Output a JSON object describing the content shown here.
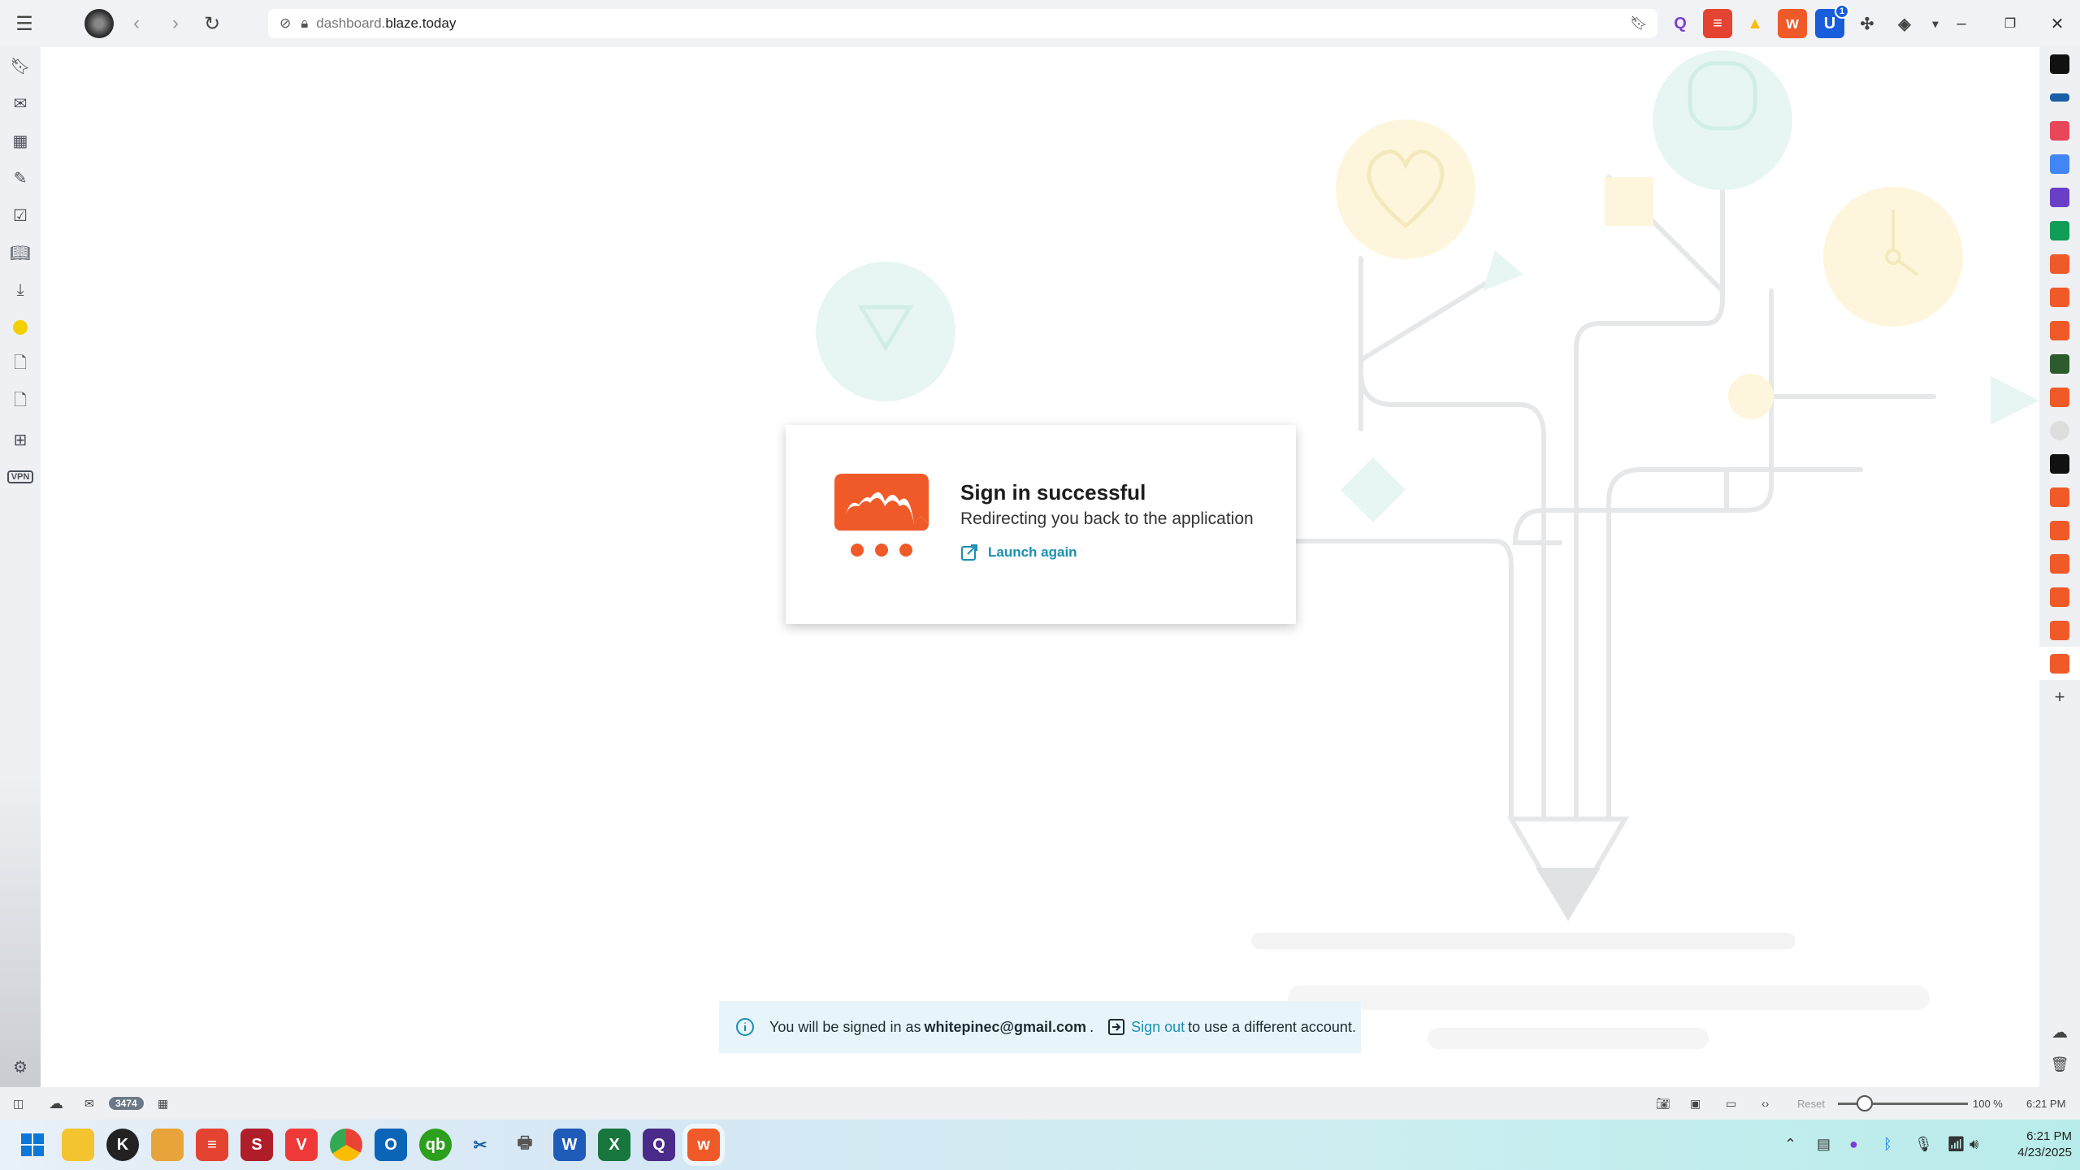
{
  "browser": {
    "url_prefix": "dashboard.",
    "url_host": "blaze.today",
    "extension_badge": "1"
  },
  "card": {
    "title": "Sign in successful",
    "subtitle": "Redirecting you back to the application",
    "launch_label": "Launch again"
  },
  "notice": {
    "prefix": "You will be signed in as",
    "email": "whitepinec@gmail.com",
    "period": ".",
    "signout_label": "Sign out",
    "suffix": "to use a different account."
  },
  "statusbar": {
    "mail_count": "3474",
    "reset_label": "Reset",
    "zoom": "100 %",
    "time": "6:21 PM"
  },
  "taskbar": {
    "time": "6:21 PM",
    "date": "4/23/2025"
  },
  "colors": {
    "brand": "#f05a28",
    "link": "#1a8fb2",
    "notice_bg": "#e7f5fb"
  }
}
